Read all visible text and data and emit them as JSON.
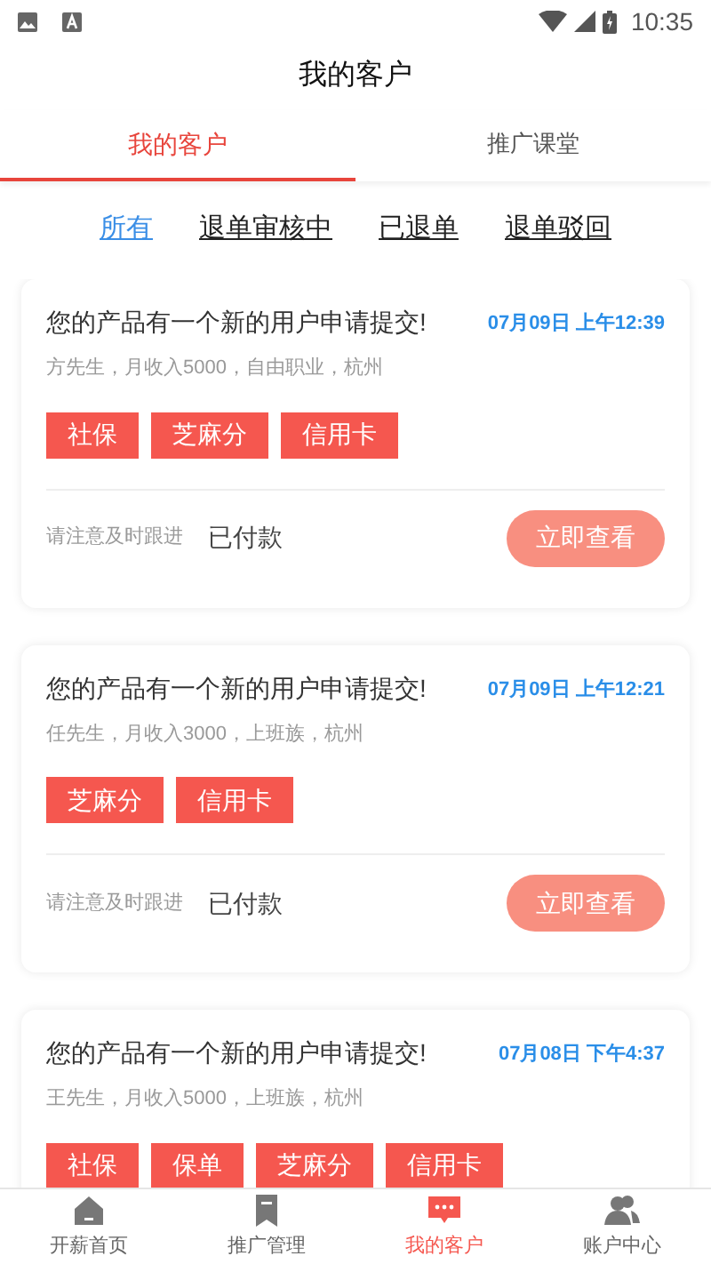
{
  "status_bar": {
    "time": "10:35"
  },
  "header": {
    "title": "我的客户"
  },
  "tabs": [
    {
      "label": "我的客户",
      "selected": true
    },
    {
      "label": "推广课堂",
      "selected": false
    }
  ],
  "filters": [
    {
      "label": "所有",
      "selected": true
    },
    {
      "label": "退单审核中",
      "selected": false
    },
    {
      "label": "已退单",
      "selected": false
    },
    {
      "label": "退单驳回",
      "selected": false
    }
  ],
  "cards": [
    {
      "title": "您的产品有一个新的用户申请提交!",
      "time": "07月09日 上午12:39",
      "details": "方先生，月收入5000，自由职业，杭州",
      "tags": [
        "社保",
        "芝麻分",
        "信用卡"
      ],
      "footer": {
        "hint": "请注意及时跟进",
        "status": "已付款",
        "button": "立即查看"
      }
    },
    {
      "title": "您的产品有一个新的用户申请提交!",
      "time": "07月09日 上午12:21",
      "details": "任先生，月收入3000，上班族，杭州",
      "tags": [
        "芝麻分",
        "信用卡"
      ],
      "footer": {
        "hint": "请注意及时跟进",
        "status": "已付款",
        "button": "立即查看"
      }
    },
    {
      "title": "您的产品有一个新的用户申请提交!",
      "time": "07月08日 下午4:37",
      "details": "王先生，月收入5000，上班族，杭州",
      "tags": [
        "社保",
        "保单",
        "芝麻分",
        "信用卡"
      ]
    }
  ],
  "bottom_nav": [
    {
      "kind": "home",
      "label": "开薪首页",
      "selected": false
    },
    {
      "kind": "bookmark",
      "label": "推广管理",
      "selected": false
    },
    {
      "kind": "chat",
      "label": "我的客户",
      "selected": true
    },
    {
      "kind": "people",
      "label": "账户中心",
      "selected": false
    }
  ]
}
